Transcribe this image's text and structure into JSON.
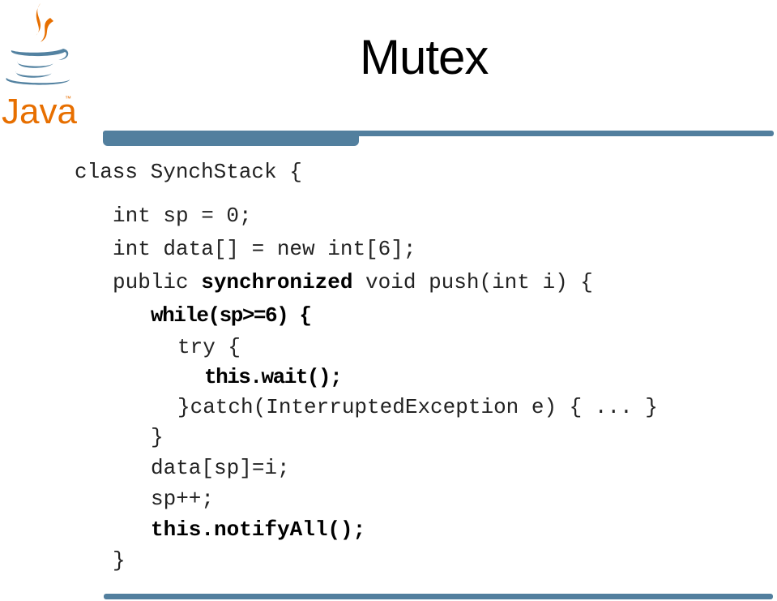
{
  "slide": {
    "title": "Mutex",
    "logo_text": "Java",
    "logo_tm": "™",
    "accent_color": "#527f9e",
    "logo_orange": "#e76f00",
    "logo_blue": "#5382a1"
  },
  "code": {
    "lines": [
      {
        "parts": [
          "class SynchStack {"
        ]
      },
      {
        "parts": [
          "int sp = 0;"
        ]
      },
      {
        "parts": [
          "int data[] = new int[6];"
        ]
      },
      {
        "parts": [
          "public ",
          "synchronized",
          " void push(int i) {"
        ]
      },
      {
        "parts": [
          "while(sp>=6) {"
        ]
      },
      {
        "parts": [
          "try {"
        ]
      },
      {
        "parts": [
          "this.wait();"
        ]
      },
      {
        "parts": [
          "}catch(InterruptedException e) { ... }"
        ]
      },
      {
        "parts": [
          "}"
        ]
      },
      {
        "parts": [
          "data[sp]=i;"
        ]
      },
      {
        "parts": [
          "sp++;"
        ]
      },
      {
        "parts": [
          "this.notifyAll();"
        ]
      },
      {
        "parts": [
          "}"
        ]
      }
    ]
  }
}
